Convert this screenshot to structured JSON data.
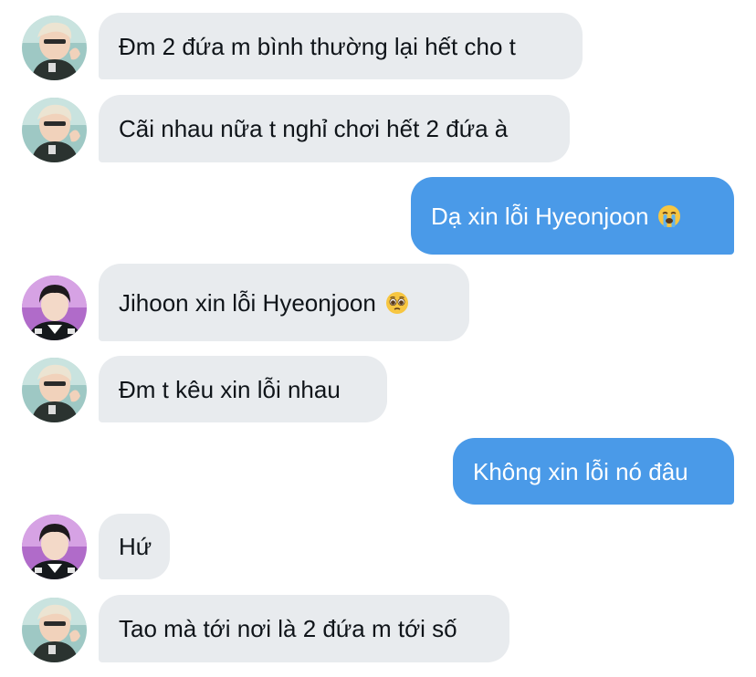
{
  "messages": [
    {
      "side": "incoming",
      "avatar": "user-avatar-blond",
      "text": "Đm 2 đứa m bình thường lại hết cho t"
    },
    {
      "side": "incoming",
      "avatar": "user-avatar-blond",
      "text": "Cãi nhau nữa t nghỉ chơi hết 2 đứa à"
    },
    {
      "side": "outgoing",
      "text": "Dạ xin lỗi Hyeonjoon",
      "emoji": "loudly-crying-face-icon"
    },
    {
      "side": "incoming",
      "avatar": "user-avatar-darkhair",
      "text": "Jihoon xin lỗi Hyeonjoon",
      "emoji": "pleading-face-icon"
    },
    {
      "side": "incoming",
      "avatar": "user-avatar-blond",
      "text": "Đm t kêu xin lỗi nhau"
    },
    {
      "side": "outgoing",
      "text": "Không xin lỗi nó đâu"
    },
    {
      "side": "incoming",
      "avatar": "user-avatar-darkhair",
      "text": "Hứ"
    },
    {
      "side": "incoming",
      "avatar": "user-avatar-blond",
      "text": "Tao mà tới nơi là 2 đứa m tới số"
    }
  ],
  "colors": {
    "incoming_bubble": "#e8ebee",
    "outgoing_bubble": "#4a9ae8",
    "incoming_text": "#0f1419",
    "outgoing_text": "#ffffff"
  }
}
